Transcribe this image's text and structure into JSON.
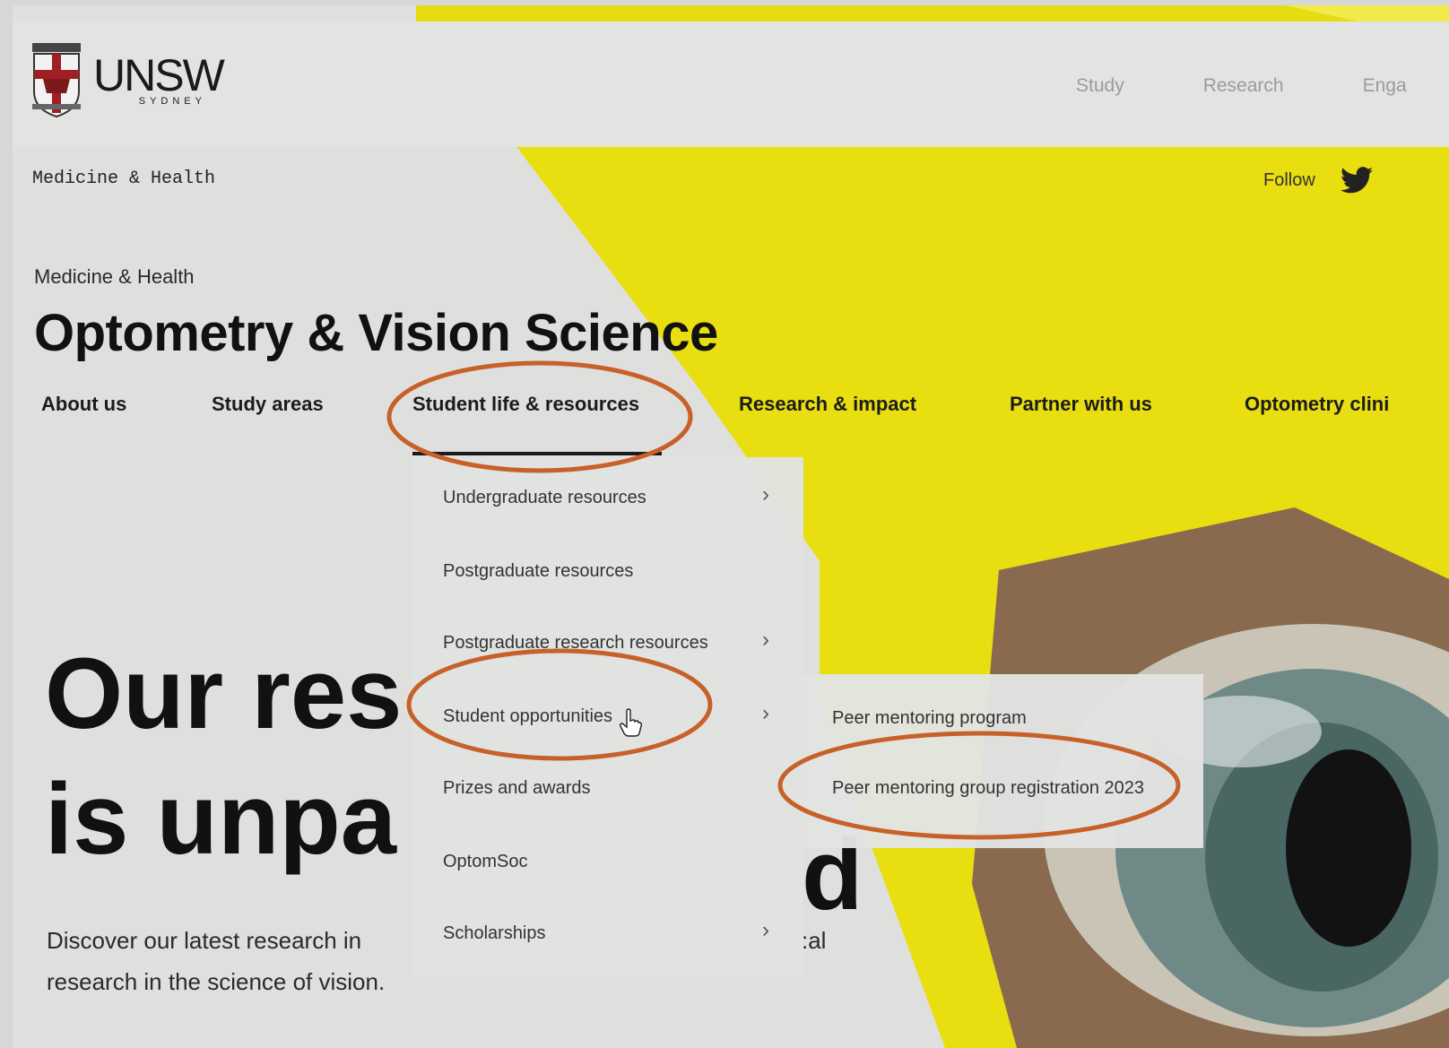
{
  "brand": {
    "name": "UNSW",
    "sub": "SYDNEY"
  },
  "top_nav": [
    "Study",
    "Research",
    "Enga"
  ],
  "faculty_mono": "Medicine & Health",
  "follow_label": "Follow",
  "faculty_label": "Medicine & Health",
  "site_title": "Optometry & Vision Science",
  "main_nav": [
    {
      "label": "About us"
    },
    {
      "label": "Study areas"
    },
    {
      "label": "Student life & resources"
    },
    {
      "label": "Research & impact"
    },
    {
      "label": "Partner with us"
    },
    {
      "label": "Optometry clini"
    }
  ],
  "dropdown": [
    {
      "label": "Undergraduate resources",
      "has_submenu": true
    },
    {
      "label": "Postgraduate resources",
      "has_submenu": false
    },
    {
      "label": "Postgraduate research resources",
      "has_submenu": true
    },
    {
      "label": "Student opportunities",
      "has_submenu": true
    },
    {
      "label": "Prizes and awards",
      "has_submenu": false
    },
    {
      "label": "OptomSoc",
      "has_submenu": false
    },
    {
      "label": "Scholarships",
      "has_submenu": true
    }
  ],
  "submenu": [
    {
      "label": "Peer mentoring program"
    },
    {
      "label": "Peer mentoring group registration 2023"
    }
  ],
  "hero": {
    "line1": "Our res",
    "line2": "is unpa",
    "tail": "d",
    "para1": "Discover our latest research in",
    "para1_tail": ":al",
    "para2": "research in the science of vision."
  },
  "colors": {
    "yellow": "#e9e10a",
    "annotation": "#c8602a",
    "text": "#1b1b1b"
  },
  "icons": {
    "chevron": "›",
    "twitter": "twitter-bird-icon",
    "cursor": "hand-pointer-icon"
  }
}
